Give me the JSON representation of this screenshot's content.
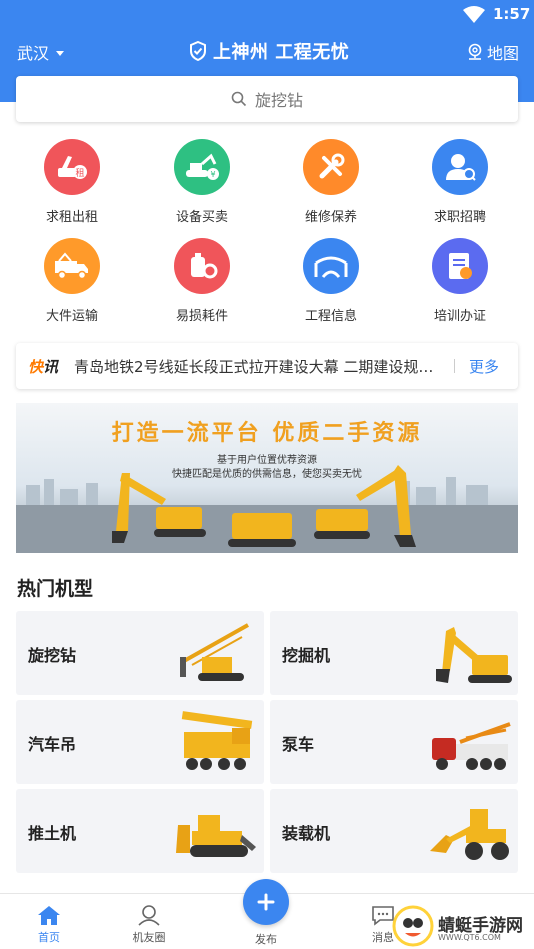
{
  "status": {
    "time": "1:57"
  },
  "header": {
    "city": "武汉",
    "slogan": "上神州 工程无忧",
    "map_label": "地图"
  },
  "search": {
    "placeholder": "旋挖钻"
  },
  "categories": [
    {
      "label": "求租出租",
      "icon": "crane-rent-icon",
      "color": "#f0555a"
    },
    {
      "label": "设备买卖",
      "icon": "excavator-trade-icon",
      "color": "#2ec082"
    },
    {
      "label": "维修保养",
      "icon": "tools-icon",
      "color": "#ff8a2a"
    },
    {
      "label": "求职招聘",
      "icon": "recruit-icon",
      "color": "#3b86f0"
    },
    {
      "label": "大件运输",
      "icon": "truck-icon",
      "color": "#ff9a2a"
    },
    {
      "label": "易损耗件",
      "icon": "parts-icon",
      "color": "#f0555a"
    },
    {
      "label": "工程信息",
      "icon": "bridge-icon",
      "color": "#3b86f0"
    },
    {
      "label": "培训办证",
      "icon": "certificate-icon",
      "color": "#5b6bf0"
    }
  ],
  "news": {
    "tag_prefix": "快",
    "tag_suffix": "讯",
    "text": "青岛地铁2号线延长段正式拉开建设大幕 二期建设规划...",
    "more": "更多"
  },
  "banner": {
    "title": "打造一流平台 优质二手资源",
    "subtitle1": "基于用户位置优荐资源",
    "subtitle2": "快捷匹配是优质的供需信息，使您买卖无忧"
  },
  "hot_models": {
    "title": "热门机型",
    "items": [
      {
        "label": "旋挖钻",
        "icon": "rotary-drill-icon"
      },
      {
        "label": "挖掘机",
        "icon": "excavator-icon"
      },
      {
        "label": "汽车吊",
        "icon": "truck-crane-icon"
      },
      {
        "label": "泵车",
        "icon": "pump-truck-icon"
      },
      {
        "label": "推土机",
        "icon": "bulldozer-icon"
      },
      {
        "label": "装载机",
        "icon": "loader-icon"
      }
    ]
  },
  "tabbar": {
    "items": [
      {
        "label": "首页",
        "active": true
      },
      {
        "label": "机友圈",
        "active": false
      },
      {
        "label": "发布",
        "active": false
      },
      {
        "label": "消息",
        "active": false
      }
    ]
  },
  "watermark": {
    "text": "蜻蜓手游网",
    "url": "WWW.QT6.COM"
  },
  "colors": {
    "primary": "#3b86f0",
    "accent_orange": "#ff7a00"
  }
}
